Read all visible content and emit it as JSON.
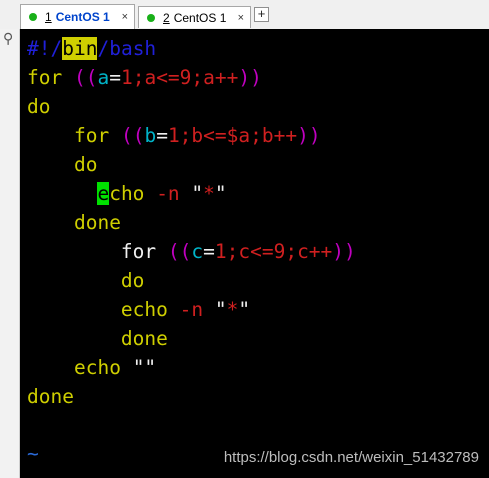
{
  "tabs": [
    {
      "number": "1",
      "label": "CentOS 1",
      "close": "×",
      "active": true
    },
    {
      "number": "2",
      "label": "CentOS 1",
      "close": "×",
      "active": false
    }
  ],
  "add_tab_label": "+",
  "icons": {
    "search": "search-icon",
    "status_dot": "green-dot-icon"
  },
  "colors": {
    "status_dot": "#19b019",
    "keyword": "#cfcf00",
    "paren": "#c000c0",
    "variable": "#00b4c8",
    "number": "#d02020",
    "comment": "#2020d8",
    "cursor": "#00e000"
  },
  "editor": {
    "shebang_prefix": "#!/",
    "shebang_bin": "bin",
    "shebang_suffix": "/bash",
    "line2": {
      "kw": "for",
      "open": "((",
      "var1": "a",
      "eq": "=",
      "rest": "1;a<=9;a++",
      "close": "))"
    },
    "line3": "do",
    "line4": {
      "kw": "for",
      "open": "((",
      "var1": "b",
      "eq": "=",
      "rest": "1;b<=$a;b++",
      "close": "))"
    },
    "line5": "do",
    "line6": {
      "cursor_char": "e",
      "cmd_rest": "cho",
      "opt": "-n",
      "q1": "\"",
      "star": "*",
      "q2": "\""
    },
    "line7": "done",
    "line8": {
      "kw": "for",
      "open": "((",
      "var1": "c",
      "eq": "=",
      "rest": "1;c<=9;c++",
      "close": "))"
    },
    "line9": "do",
    "line10": {
      "cmd": "echo",
      "opt": "-n",
      "q1": "\"",
      "star": "*",
      "q2": "\""
    },
    "line11": "done",
    "line12": {
      "cmd": "echo",
      "str": "\"\""
    },
    "line13": "done",
    "tilde": "~"
  },
  "watermark": "https://blog.csdn.net/weixin_51432789"
}
